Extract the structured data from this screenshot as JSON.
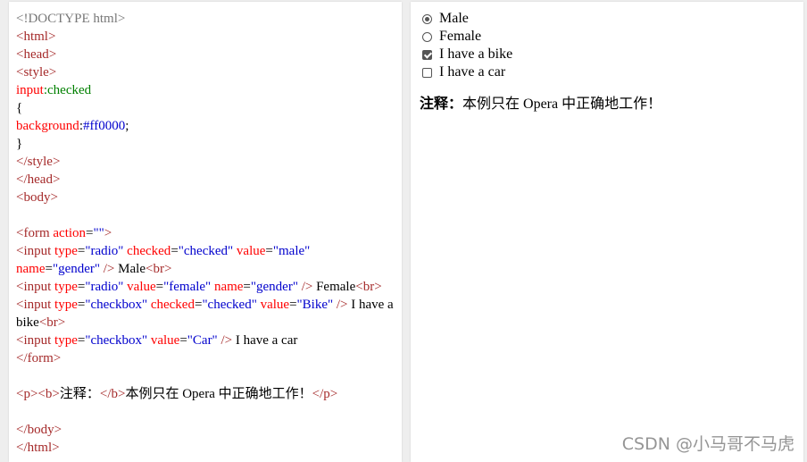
{
  "code": {
    "doctype": "<!DOCTYPE html>",
    "html_open": "<html>",
    "head_open": "<head>",
    "style_open": "<style>",
    "selector": "input",
    "pseudo": ":checked",
    "brace_open": "{",
    "prop": "background",
    "colon": ":",
    "value": "#ff0000",
    "semi": ";",
    "brace_close": "}",
    "style_close": "</style>",
    "head_close": "</head>",
    "body_open": "<body>",
    "form_open_tag": "<form",
    "form_action_attr": "action",
    "form_action_val": "\"\"",
    "form_gt": ">",
    "input_tag": "<input",
    "type_attr": "type",
    "radio_val": "\"radio\"",
    "checked_attr": "checked",
    "checked_val": "\"checked\"",
    "value_attr": "value",
    "male_val": "\"male\"",
    "name_attr": "name",
    "gender_val": "\"gender\"",
    "self_close": "/>",
    "male_text": "Male",
    "br": "<br>",
    "female_val": "\"female\"",
    "female_text": "Female",
    "checkbox_val": "\"checkbox\"",
    "bike_val": "\"Bike\"",
    "bike_text_1": "I have a",
    "bike_text_2": "bike",
    "car_val": "\"Car\"",
    "car_text": "I have a car",
    "form_close": "</form>",
    "p_open": "<p>",
    "b_open": "<b>",
    "note_label": "注释：",
    "b_close": "</b>",
    "note_text": "本例只在 Opera 中正确地工作！",
    "p_close": "</p>",
    "body_close": "</body>",
    "html_close": "</html>",
    "eq": "="
  },
  "result": {
    "options": [
      {
        "label": "Male",
        "type": "radio",
        "checked": true
      },
      {
        "label": "Female",
        "type": "radio",
        "checked": false
      },
      {
        "label": "I have a bike",
        "type": "checkbox",
        "checked": true
      },
      {
        "label": "I have a car",
        "type": "checkbox",
        "checked": false
      }
    ],
    "note_label": "注释：",
    "note_text": "本例只在 Opera 中正确地工作！"
  },
  "watermark": "CSDN @小马哥不马虎",
  "colors": {
    "tag": "#a52a2a",
    "attr_name": "#ff0000",
    "attr_value": "#0000cd",
    "pseudo": "#008000",
    "panel_bg": "#ffffff",
    "page_bg": "#eeeeee"
  }
}
